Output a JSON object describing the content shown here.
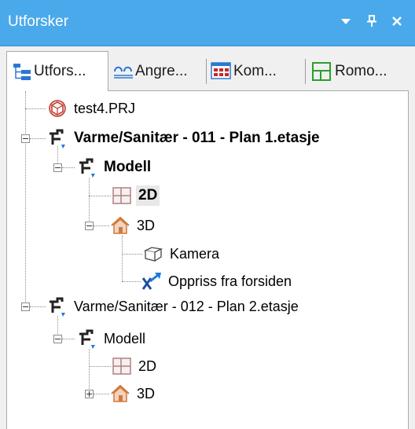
{
  "window": {
    "title": "Utforsker"
  },
  "titlebar_buttons": [
    "dropdown-arrow-icon",
    "pin-icon",
    "close-icon"
  ],
  "tabs": [
    {
      "label": "Utfors...",
      "icon": "explorer-tree-icon",
      "active": true
    },
    {
      "label": "Angre...",
      "icon": "undo-history-icon",
      "active": false
    },
    {
      "label": "Kom...",
      "icon": "components-grid-icon",
      "active": false
    },
    {
      "label": "Romo...",
      "icon": "room-icon",
      "active": false
    }
  ],
  "tree": {
    "project": {
      "label": "test4.PRJ",
      "icon": "project-icon"
    },
    "model1": {
      "label": "Varme/Sanitær - 011 - Plan 1.etasje",
      "icon": "plumbing-icon",
      "modell": "Modell",
      "view2d": "2D",
      "view3d": "3D",
      "camera": "Kamera",
      "elevation": "Oppriss fra forsiden"
    },
    "model2": {
      "label": "Varme/Sanitær - 012 - Plan 2.etasje",
      "icon": "plumbing-icon",
      "modell": "Modell",
      "view2d": "2D",
      "view3d": "3D"
    }
  },
  "colors": {
    "titlebar": "#4aa9ea",
    "panel": "#ffffff",
    "accent": "#1e7ad6"
  }
}
